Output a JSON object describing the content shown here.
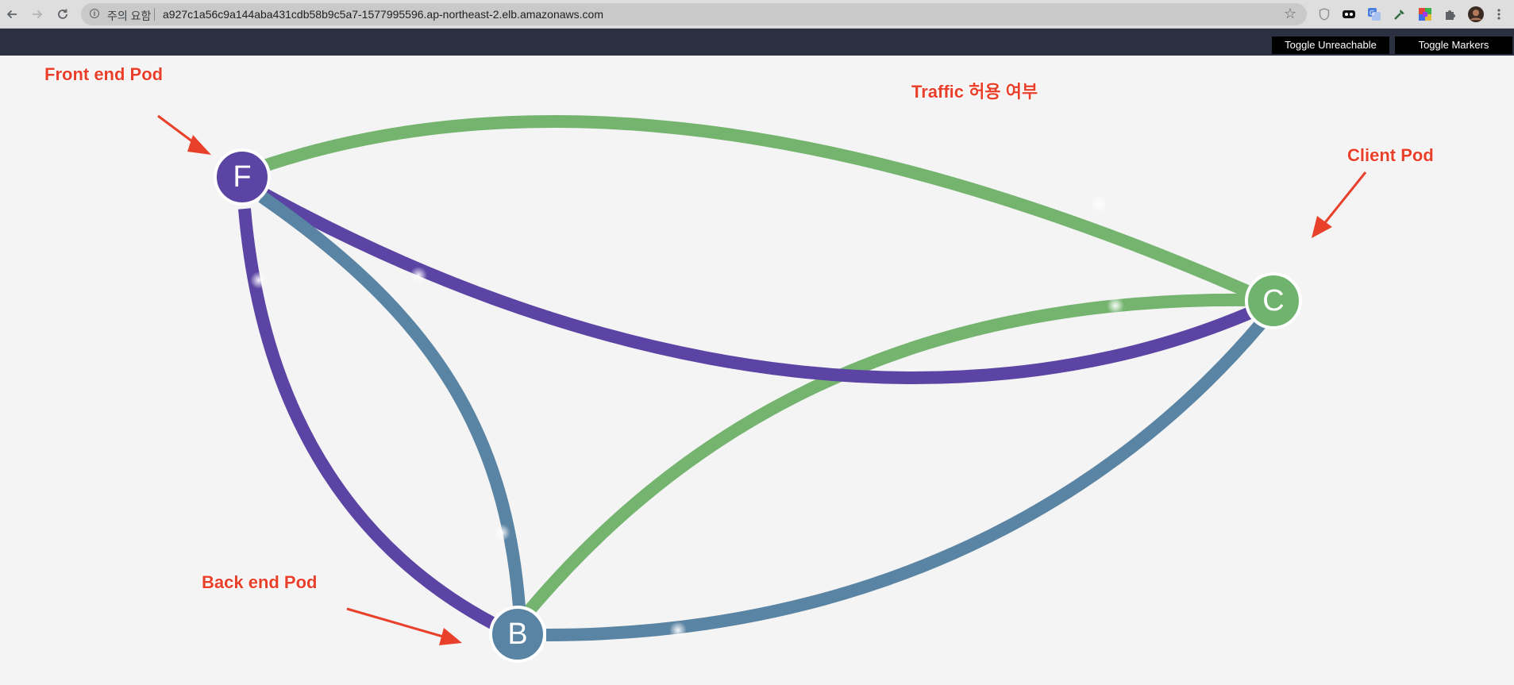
{
  "browser": {
    "security_label": "주의 요함",
    "url": "a927c1a56c9a144aba431cdb58b9c5a7-1577995596.ap-northeast-2.elb.amazonaws.com",
    "back_icon": "arrow-left-icon",
    "forward_icon": "arrow-right-icon",
    "reload_icon": "reload-icon",
    "extensions": [
      "shield-extension-icon",
      "ghost-extension-icon",
      "translate-extension-icon",
      "eyedropper-extension-icon",
      "color-grid-extension-icon",
      "puzzle-extensions-icon",
      "profile-avatar",
      "menu-kebab-icon"
    ]
  },
  "toolbar": {
    "toggle_unreachable": "Toggle Unreachable",
    "toggle_markers": "Toggle Markers"
  },
  "graph": {
    "nodes": [
      {
        "id": "F",
        "label": "F",
        "color": "#5b44a3"
      },
      {
        "id": "C",
        "label": "C",
        "color": "#6fb36f"
      },
      {
        "id": "B",
        "label": "B",
        "color": "#5a84a3"
      }
    ],
    "edges": [
      {
        "from": "F",
        "to": "C",
        "color": "#74b46f",
        "route": "upper-arc"
      },
      {
        "from": "F",
        "to": "C",
        "color": "#5b44a3",
        "route": "lower-arc"
      },
      {
        "from": "F",
        "to": "B",
        "color": "#5b44a3",
        "route": "outer-arc"
      },
      {
        "from": "F",
        "to": "B",
        "color": "#5a84a3",
        "route": "inner-arc"
      },
      {
        "from": "B",
        "to": "C",
        "color": "#74b46f",
        "route": "upper-arc"
      },
      {
        "from": "B",
        "to": "C",
        "color": "#5a84a3",
        "route": "lower-arc"
      }
    ]
  },
  "annotations": {
    "front_end": "Front end Pod",
    "traffic": "Traffic 허용 여부",
    "client": "Client Pod",
    "back_end": "Back end Pod",
    "color": "#e8402b"
  }
}
